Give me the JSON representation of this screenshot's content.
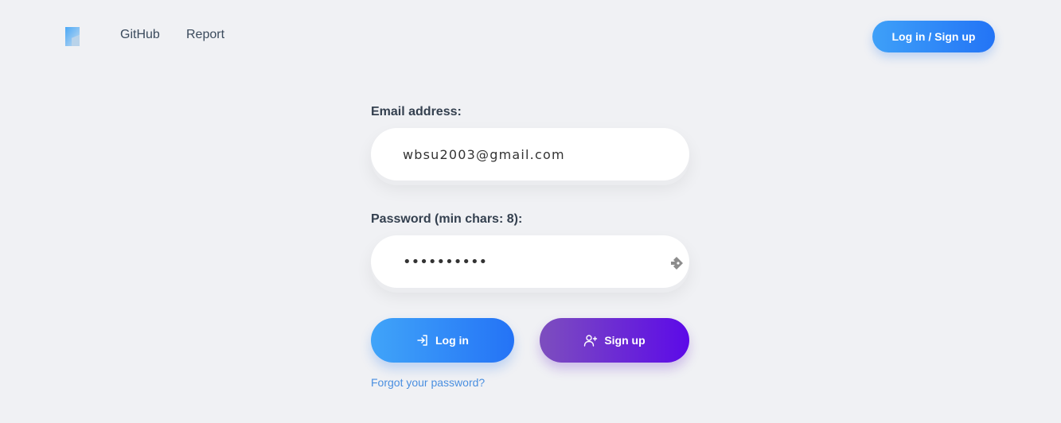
{
  "header": {
    "logo_icon": "app-logo-icon",
    "nav": [
      {
        "label": "GitHub"
      },
      {
        "label": "Report"
      }
    ],
    "auth_button_label": "Log in / Sign up"
  },
  "form": {
    "email_label": "Email address:",
    "email_value": "wbsu2003@gmail.com",
    "password_label": "Password (min chars: 8):",
    "password_value": "••••••••••",
    "password_toggle_icon": "password-manager-key-icon",
    "login_label": "Log in",
    "login_icon": "sign-in-icon",
    "signup_label": "Sign up",
    "signup_icon": "user-plus-icon",
    "forgot_label": "Forgot your password?"
  },
  "colors": {
    "background": "#f0f1f4",
    "primary_blue": "#2374f6",
    "primary_purple": "#5c0ae8",
    "link": "#4a8fe0"
  }
}
